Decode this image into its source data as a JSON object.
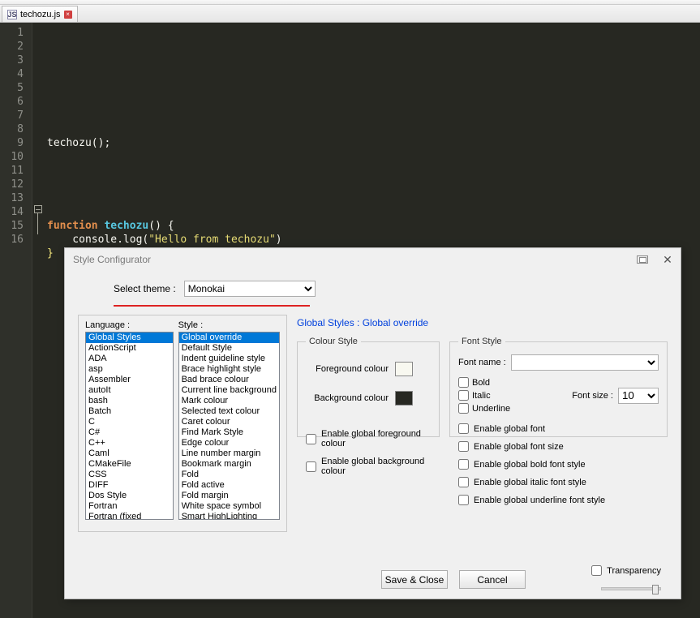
{
  "tab": {
    "filename": "techozu.js"
  },
  "code": {
    "line_numbers": [
      "1",
      "2",
      "3",
      "4",
      "5",
      "6",
      "7",
      "8",
      "9",
      "10",
      "11",
      "12",
      "13",
      "14",
      "15",
      "16"
    ],
    "l8": "techozu();",
    "l14_kw": "function",
    "l14_fn": " techozu",
    "l14_rest": "() {",
    "l15_call": "    console.log(",
    "l15_str": "\"Hello from techozu\"",
    "l15_end": ")",
    "l16": "}"
  },
  "dialog": {
    "title": "Style Configurator",
    "select_theme_label": "Select theme :",
    "theme": "Monokai",
    "language_label": "Language :",
    "style_label": "Style :",
    "languages": [
      "Global Styles",
      "ActionScript",
      "ADA",
      "asp",
      "Assembler",
      "autoIt",
      "bash",
      "Batch",
      "C",
      "C#",
      "C++",
      "Caml",
      "CMakeFile",
      "CSS",
      "DIFF",
      "Dos Style",
      "Fortran",
      "Fortran (fixed"
    ],
    "styles": [
      "Global override",
      "Default Style",
      "Indent guideline style",
      "Brace highlight style",
      "Bad brace colour",
      "Current line background",
      "Mark colour",
      "Selected text colour",
      "Caret colour",
      "Find Mark Style",
      "Edge colour",
      "Line number margin",
      "Bookmark margin",
      "Fold",
      "Fold active",
      "Fold margin",
      "White space symbol",
      "Smart HighLighting"
    ],
    "breadcrumb": "Global Styles : Global override",
    "colour_legend": "Colour Style",
    "fg_label": "Foreground colour",
    "bg_label": "Background colour",
    "font_legend": "Font Style",
    "font_name_label": "Font name :",
    "bold": "Bold",
    "italic": "Italic",
    "underline": "Underline",
    "font_size_label": "Font size :",
    "font_size": "10",
    "enable_fg": "Enable global foreground colour",
    "enable_bg": "Enable global background colour",
    "enable_font": "Enable global font",
    "enable_font_size": "Enable global font size",
    "enable_bold": "Enable global bold font style",
    "enable_italic": "Enable global italic font style",
    "enable_underline": "Enable global underline font style",
    "save_close": "Save & Close",
    "cancel": "Cancel",
    "transparency": "Transparency"
  }
}
